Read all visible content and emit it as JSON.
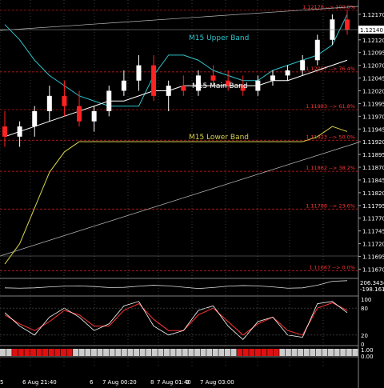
{
  "chart_data": {
    "type": "candlestick",
    "title": "",
    "main_pane": {
      "ylim": [
        1.11655,
        1.12195
      ],
      "y_ticks": [
        "1.12170",
        "1.12140",
        "1.12120",
        "1.12095",
        "1.12070",
        "1.12045",
        "1.12020",
        "1.11995",
        "1.11970",
        "1.11945",
        "1.11920",
        "1.11895",
        "1.11870",
        "1.11845",
        "1.11820",
        "1.11795",
        "1.11770",
        "1.11745",
        "1.11720",
        "1.11695",
        "1.11670"
      ],
      "current_price": "1.12140",
      "fibonacci_levels": [
        {
          "price": 1.12178,
          "label": "1.12178 --> 100.0%"
        },
        {
          "price": 1.12057,
          "label": "1.12057 --> 76.4%"
        },
        {
          "price": 1.11983,
          "label": "1.11983 --> 61.8%"
        },
        {
          "price": 1.11923,
          "label": "1.11923 --> 50.0%"
        },
        {
          "price": 1.11862,
          "label": "1.11862 --> 38.2%"
        },
        {
          "price": 1.11788,
          "label": "1.11788 --> 23.6%"
        },
        {
          "price": 1.11667,
          "label": "1.11667 --> 0.0%"
        }
      ],
      "band_labels": {
        "upper": "M15 Upper Band",
        "main": "M15 Main Band",
        "lower": "M15 Lower Band"
      },
      "band_colors": {
        "upper": "#2ec4cc",
        "main": "#ffffff",
        "lower": "#d8d24a"
      },
      "upper_band": [
        1.1215,
        1.1212,
        1.1208,
        1.1205,
        1.1203,
        1.1201,
        1.12,
        1.1199,
        1.1199,
        1.1199,
        1.1205,
        1.1209,
        1.1209,
        1.1208,
        1.1206,
        1.1205,
        1.1204,
        1.1204,
        1.1206,
        1.1207,
        1.1208,
        1.1209,
        1.1211,
        1.1217
      ],
      "main_band": [
        1.1193,
        1.1194,
        1.1195,
        1.1196,
        1.1197,
        1.1198,
        1.1199,
        1.12,
        1.12,
        1.1201,
        1.1202,
        1.1202,
        1.1203,
        1.1203,
        1.1203,
        1.1203,
        1.1203,
        1.1203,
        1.1204,
        1.1204,
        1.1205,
        1.1206,
        1.1207,
        1.1208
      ],
      "lower_band": [
        1.1168,
        1.1172,
        1.1179,
        1.1186,
        1.119,
        1.1192,
        1.1192,
        1.1192,
        1.1192,
        1.1192,
        1.1192,
        1.1192,
        1.1192,
        1.1192,
        1.1192,
        1.1192,
        1.1192,
        1.1192,
        1.1192,
        1.1192,
        1.1192,
        1.1193,
        1.1195,
        1.1194
      ],
      "candles": [
        {
          "o": 1.1195,
          "h": 1.1198,
          "l": 1.1191,
          "c": 1.1193
        },
        {
          "o": 1.1193,
          "h": 1.1196,
          "l": 1.1191,
          "c": 1.1195
        },
        {
          "o": 1.1195,
          "h": 1.1199,
          "l": 1.1193,
          "c": 1.1198
        },
        {
          "o": 1.1198,
          "h": 1.1203,
          "l": 1.1196,
          "c": 1.1201
        },
        {
          "o": 1.1201,
          "h": 1.1204,
          "l": 1.1197,
          "c": 1.1199
        },
        {
          "o": 1.1199,
          "h": 1.1202,
          "l": 1.1195,
          "c": 1.1196
        },
        {
          "o": 1.1196,
          "h": 1.1199,
          "l": 1.1194,
          "c": 1.1198
        },
        {
          "o": 1.1198,
          "h": 1.1203,
          "l": 1.1197,
          "c": 1.1202
        },
        {
          "o": 1.1202,
          "h": 1.1206,
          "l": 1.1201,
          "c": 1.1204
        },
        {
          "o": 1.1204,
          "h": 1.1209,
          "l": 1.1202,
          "c": 1.1207
        },
        {
          "o": 1.1207,
          "h": 1.1209,
          "l": 1.12,
          "c": 1.1201
        },
        {
          "o": 1.1201,
          "h": 1.1204,
          "l": 1.1198,
          "c": 1.1203
        },
        {
          "o": 1.1203,
          "h": 1.1205,
          "l": 1.1201,
          "c": 1.1202
        },
        {
          "o": 1.1202,
          "h": 1.1206,
          "l": 1.1201,
          "c": 1.1205
        },
        {
          "o": 1.1205,
          "h": 1.1207,
          "l": 1.1203,
          "c": 1.1204
        },
        {
          "o": 1.1204,
          "h": 1.1206,
          "l": 1.1202,
          "c": 1.1203
        },
        {
          "o": 1.1203,
          "h": 1.1205,
          "l": 1.1201,
          "c": 1.1202
        },
        {
          "o": 1.1202,
          "h": 1.1205,
          "l": 1.1201,
          "c": 1.1204
        },
        {
          "o": 1.1204,
          "h": 1.1206,
          "l": 1.1203,
          "c": 1.1205
        },
        {
          "o": 1.1205,
          "h": 1.1207,
          "l": 1.1204,
          "c": 1.1206
        },
        {
          "o": 1.1206,
          "h": 1.1209,
          "l": 1.1205,
          "c": 1.1208
        },
        {
          "o": 1.1208,
          "h": 1.1213,
          "l": 1.1207,
          "c": 1.1212
        },
        {
          "o": 1.1212,
          "h": 1.1217,
          "l": 1.1211,
          "c": 1.1216
        },
        {
          "o": 1.1216,
          "h": 1.1218,
          "l": 1.1213,
          "c": 1.1214
        }
      ]
    },
    "osc1_pane": {
      "labels": [
        "206.3434",
        "-198.161"
      ],
      "values": [
        -20,
        -30,
        -20,
        10,
        30,
        40,
        20,
        -10,
        -5,
        30,
        60,
        40,
        0,
        -40,
        -10,
        30,
        50,
        40,
        10,
        -30,
        -20,
        60,
        180,
        200
      ]
    },
    "stoch_pane": {
      "y_ticks": [
        "100",
        "80",
        "20",
        "0"
      ],
      "main_values": [
        70,
        40,
        20,
        60,
        80,
        60,
        30,
        45,
        85,
        95,
        40,
        20,
        30,
        75,
        85,
        40,
        10,
        50,
        60,
        20,
        15,
        90,
        95,
        70
      ],
      "signal_values": [
        65,
        45,
        30,
        50,
        75,
        65,
        40,
        40,
        75,
        90,
        55,
        30,
        30,
        65,
        80,
        50,
        20,
        45,
        60,
        30,
        20,
        80,
        92,
        75
      ]
    },
    "histogram_pane": {
      "y_ticks": [
        "1.00",
        "0.00"
      ],
      "bars": [
        0,
        0,
        1,
        1,
        1,
        1,
        1,
        1,
        1,
        1,
        1,
        1,
        0,
        0,
        0,
        0,
        0,
        0,
        0,
        0,
        0,
        0,
        0,
        0,
        0,
        0,
        0,
        0,
        0,
        0,
        0,
        0,
        0,
        0,
        0,
        0,
        0,
        0,
        0,
        1,
        1,
        1,
        1,
        1,
        1,
        1,
        0,
        0,
        0,
        0,
        0,
        0,
        0,
        0,
        0,
        0,
        0,
        0,
        0
      ]
    },
    "x_labels": [
      "5",
      "6 Aug 21:40",
      "6",
      "7 Aug 00:20",
      "8",
      "7 Aug 01:40",
      "9",
      "7 Aug 03:00"
    ]
  }
}
